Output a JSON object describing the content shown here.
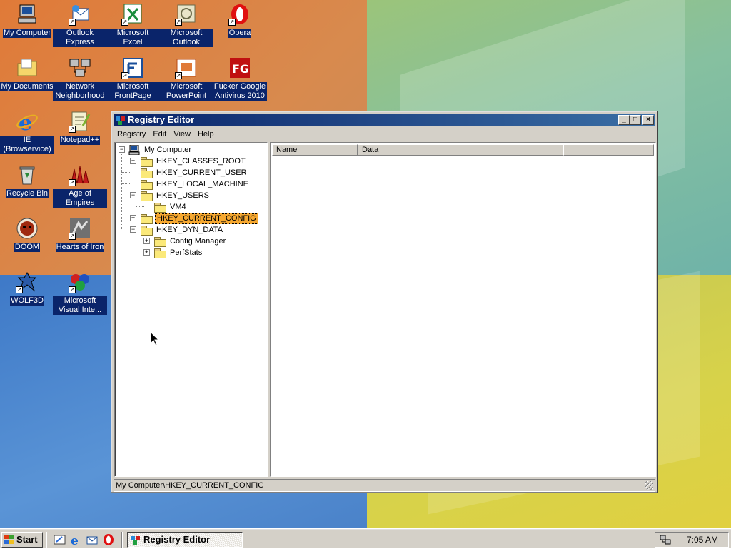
{
  "desktop": {
    "icons": [
      {
        "label": "My Computer",
        "icon": "my-computer-icon"
      },
      {
        "label": "Outlook Express",
        "icon": "outlook-express-icon"
      },
      {
        "label": "Microsoft Excel",
        "icon": "excel-icon"
      },
      {
        "label": "Microsoft Outlook",
        "icon": "outlook-icon"
      },
      {
        "label": "Opera",
        "icon": "opera-icon"
      },
      {
        "label": "My Documents",
        "icon": "my-documents-icon"
      },
      {
        "label": "Network Neighborhood",
        "icon": "network-neighborhood-icon"
      },
      {
        "label": "Microsoft FrontPage",
        "icon": "frontpage-icon"
      },
      {
        "label": "Microsoft PowerPoint",
        "icon": "powerpoint-icon"
      },
      {
        "label": "Fucker Google Antivirus 2010",
        "icon": "antivirus-icon"
      },
      {
        "label": "IE (Browservice)",
        "icon": "internet-explorer-icon"
      },
      {
        "label": "Notepad++",
        "icon": "notepad-plus-plus-icon"
      },
      {
        "label": "Recycle Bin",
        "icon": "recycle-bin-icon"
      },
      {
        "label": "Age of Empires",
        "icon": "age-of-empires-icon"
      },
      {
        "label": "DOOM",
        "icon": "doom-icon"
      },
      {
        "label": "Hearts of Iron",
        "icon": "hearts-of-iron-icon"
      },
      {
        "label": "WOLF3D",
        "icon": "wolf3d-icon"
      },
      {
        "label": "Microsoft Visual Inte...",
        "icon": "visual-interdev-icon"
      }
    ]
  },
  "window": {
    "title": "Registry Editor",
    "controls": {
      "minimize": "_",
      "maximize": "□",
      "close": "×"
    },
    "menu": [
      "Registry",
      "Edit",
      "View",
      "Help"
    ],
    "tree": {
      "root": "My Computer",
      "items": [
        {
          "label": "HKEY_CLASSES_ROOT",
          "expander": "+"
        },
        {
          "label": "HKEY_CURRENT_USER",
          "expander": ""
        },
        {
          "label": "HKEY_LOCAL_MACHINE",
          "expander": ""
        },
        {
          "label": "HKEY_USERS",
          "expander": "−"
        },
        {
          "label": "VM4",
          "expander": ""
        },
        {
          "label": "HKEY_CURRENT_CONFIG",
          "expander": "+",
          "selected": true
        },
        {
          "label": "HKEY_DYN_DATA",
          "expander": "−"
        },
        {
          "label": "Config Manager",
          "expander": "+"
        },
        {
          "label": "PerfStats",
          "expander": "+"
        }
      ]
    },
    "list": {
      "columns": [
        "Name",
        "Data"
      ]
    },
    "status": "My Computer\\HKEY_CURRENT_CONFIG"
  },
  "taskbar": {
    "start_label": "Start",
    "quick_launch": [
      "show-desktop-icon",
      "internet-explorer-icon",
      "outlook-express-icon",
      "opera-icon"
    ],
    "task_label": "Registry Editor",
    "clock": "7:05 AM"
  },
  "colors": {
    "titlebar": "#0a246a",
    "selection": "#f6a830",
    "face": "#d4d0c8"
  }
}
